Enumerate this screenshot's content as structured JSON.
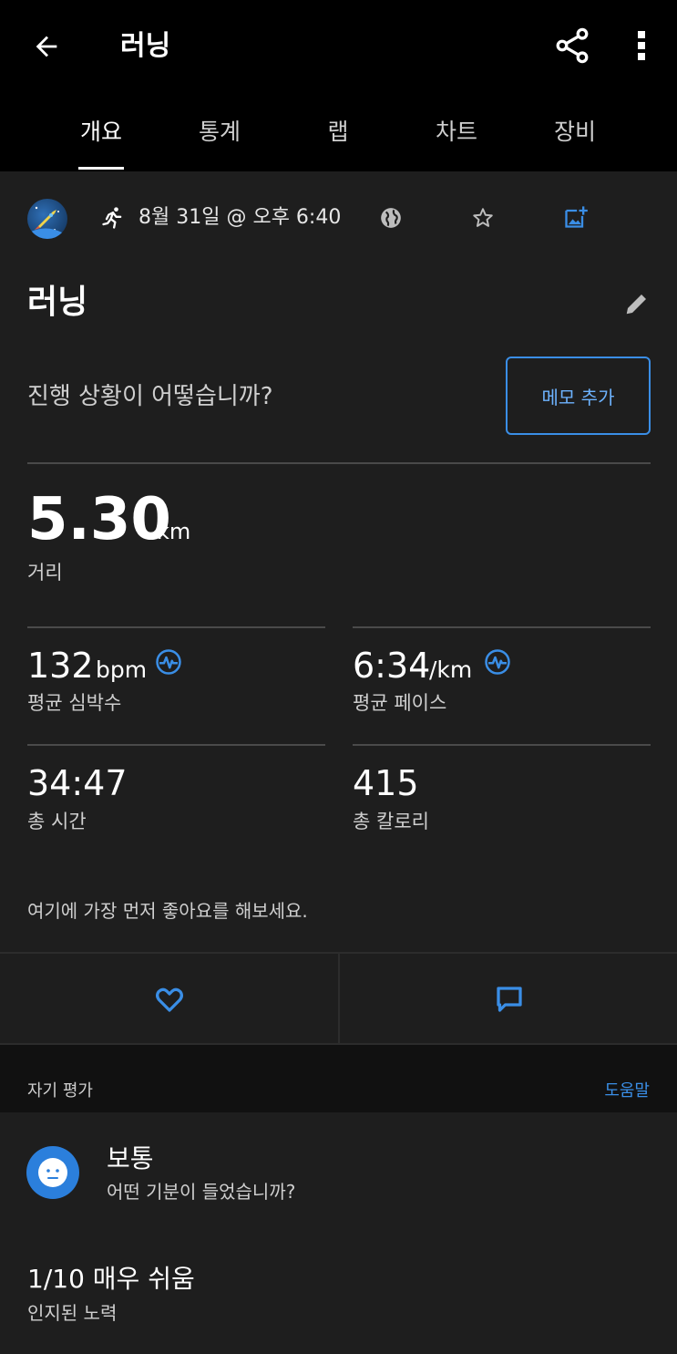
{
  "header": {
    "title": "러닝",
    "back_icon": "arrow-left-icon",
    "share_icon": "share-icon",
    "more_icon": "more-vertical-icon"
  },
  "tabs": [
    {
      "label": "개요",
      "active": true
    },
    {
      "label": "통계",
      "active": false
    },
    {
      "label": "랩",
      "active": false
    },
    {
      "label": "차트",
      "active": false
    },
    {
      "label": "장비",
      "active": false
    }
  ],
  "meta": {
    "date": "8월 31일 @ 오후 6:40"
  },
  "activity": {
    "name": "러닝",
    "prompt": "진행 상황이 어떻습니까?",
    "memo_button": "메모 추가"
  },
  "distance": {
    "value": "5.30",
    "unit": "km",
    "label": "거리"
  },
  "stats": {
    "hr": {
      "value": "132",
      "unit": "bpm",
      "label": "평균 심박수"
    },
    "pace": {
      "value": "6:34",
      "unit": "/km",
      "label": "평균 페이스"
    },
    "time": {
      "value": "34:47",
      "label": "총 시간"
    },
    "calories": {
      "value": "415",
      "label": "총 칼로리"
    }
  },
  "social": {
    "like_prompt": "여기에 가장 먼저 좋아요를 해보세요."
  },
  "self_eval": {
    "section_title": "자기 평가",
    "help": "도움말",
    "feeling": "보통",
    "feeling_prompt": "어떤 기분이 들었습니까?",
    "effort": "1/10 매우 쉬움",
    "effort_label": "인지된 노력"
  },
  "colors": {
    "accent": "#3a8ee6",
    "background": "#1e1e1e",
    "bar": "#000000"
  }
}
